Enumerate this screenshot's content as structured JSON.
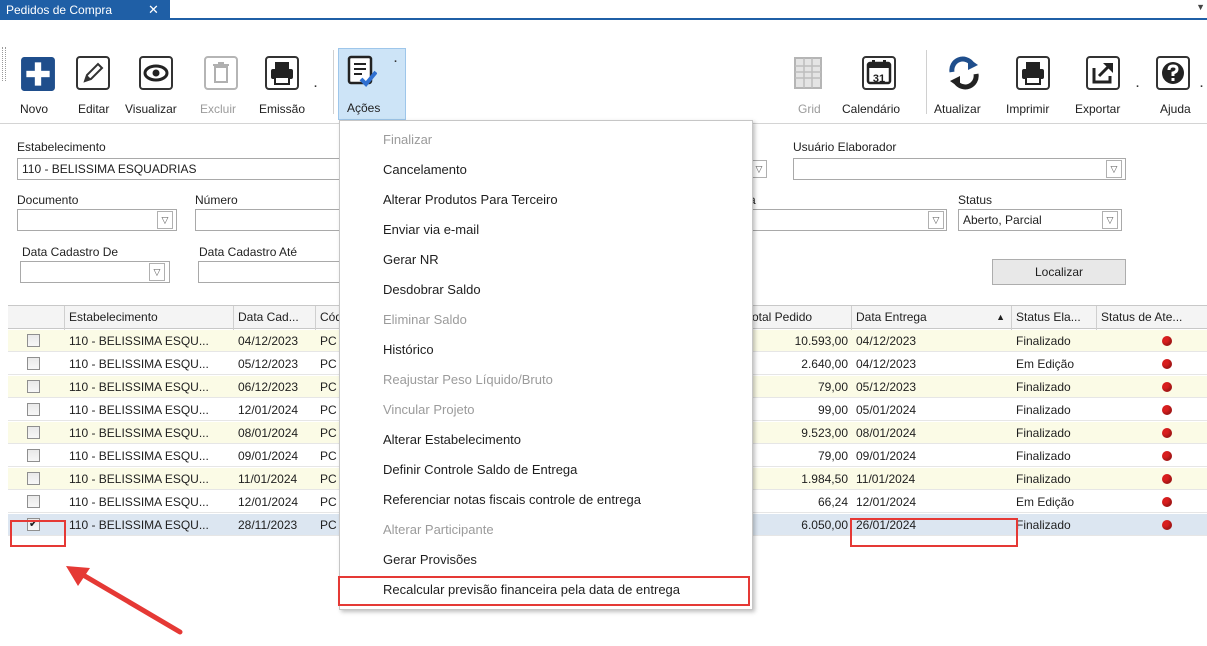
{
  "tab": {
    "title": "Pedidos de Compra",
    "close": "✕"
  },
  "toolbar": {
    "novo": "Novo",
    "editar": "Editar",
    "visualizar": "Visualizar",
    "excluir": "Excluir",
    "emissao": "Emissão",
    "acoes": "Ações",
    "grid": "Grid",
    "calendario": "Calendário",
    "calendar_day": "31",
    "atualizar": "Atualizar",
    "imprimir": "Imprimir",
    "exportar": "Exportar",
    "ajuda": "Ajuda"
  },
  "filters": {
    "estabelecimento_label": "Estabelecimento",
    "estabelecimento_value": "110 - BELISSIMA ESQUADRIAS",
    "usuario_label": "Usuário Elaborador",
    "usuario_value": "",
    "documento_label": "Documento",
    "numero_label": "Número",
    "status_label": "Status",
    "status_value": "Aberto, Parcial",
    "data_de_label": "Data Cadastro De",
    "data_ate_label": "Data Cadastro Até",
    "partial_label_a": "a",
    "localizar": "Localizar"
  },
  "grid": {
    "headers": {
      "estabelecimento": "Estabelecimento",
      "data_cad": "Data Cad...",
      "cod": "Cód",
      "total": "otal Pedido",
      "data_entrega": "Data Entrega",
      "sort_indicator": "▲",
      "status_ela": "Status Ela...",
      "status_ate": "Status de Ate..."
    },
    "rows": [
      {
        "checked": false,
        "estab": "110 - BELISSIMA ESQU...",
        "data": "04/12/2023",
        "cod": "PC",
        "total": "10.593,00",
        "entrega": "04/12/2023",
        "status": "Finalizado"
      },
      {
        "checked": false,
        "estab": "110 - BELISSIMA ESQU...",
        "data": "05/12/2023",
        "cod": "PC",
        "total": "2.640,00",
        "entrega": "04/12/2023",
        "status": "Em Edição"
      },
      {
        "checked": false,
        "estab": "110 - BELISSIMA ESQU...",
        "data": "06/12/2023",
        "cod": "PC",
        "total": "79,00",
        "entrega": "05/12/2023",
        "status": "Finalizado"
      },
      {
        "checked": false,
        "estab": "110 - BELISSIMA ESQU...",
        "data": "12/01/2024",
        "cod": "PC",
        "total": "99,00",
        "entrega": "05/01/2024",
        "status": "Finalizado"
      },
      {
        "checked": false,
        "estab": "110 - BELISSIMA ESQU...",
        "data": "08/01/2024",
        "cod": "PC",
        "total": "9.523,00",
        "entrega": "08/01/2024",
        "status": "Finalizado"
      },
      {
        "checked": false,
        "estab": "110 - BELISSIMA ESQU...",
        "data": "09/01/2024",
        "cod": "PC",
        "total": "79,00",
        "entrega": "09/01/2024",
        "status": "Finalizado"
      },
      {
        "checked": false,
        "estab": "110 - BELISSIMA ESQU...",
        "data": "11/01/2024",
        "cod": "PC",
        "total": "1.984,50",
        "entrega": "11/01/2024",
        "status": "Finalizado"
      },
      {
        "checked": false,
        "estab": "110 - BELISSIMA ESQU...",
        "data": "12/01/2024",
        "cod": "PC",
        "total": "66,24",
        "entrega": "12/01/2024",
        "status": "Em Edição"
      },
      {
        "checked": true,
        "estab": "110 - BELISSIMA ESQU...",
        "data": "28/11/2023",
        "cod": "PC",
        "total": "6.050,00",
        "entrega": "26/01/2024",
        "status": "Finalizado"
      }
    ]
  },
  "menu": {
    "items": [
      {
        "label": "Finalizar",
        "enabled": false
      },
      {
        "label": "Cancelamento",
        "enabled": true
      },
      {
        "label": "Alterar Produtos Para Terceiro",
        "enabled": true
      },
      {
        "label": "Enviar via e-mail",
        "enabled": true
      },
      {
        "label": "Gerar NR",
        "enabled": true
      },
      {
        "label": "Desdobrar Saldo",
        "enabled": true
      },
      {
        "label": "Eliminar Saldo",
        "enabled": false
      },
      {
        "label": "Histórico",
        "enabled": true
      },
      {
        "label": "Reajustar Peso Líquido/Bruto",
        "enabled": false
      },
      {
        "label": "Vincular Projeto",
        "enabled": false
      },
      {
        "label": "Alterar Estabelecimento",
        "enabled": true
      },
      {
        "label": "Definir Controle Saldo de Entrega",
        "enabled": true
      },
      {
        "label": "Referenciar notas fiscais controle de entrega",
        "enabled": true
      },
      {
        "label": "Alterar Participante",
        "enabled": false
      },
      {
        "label": "Gerar Provisões",
        "enabled": true
      },
      {
        "label": "Recalcular previsão financeira pela data de entrega",
        "enabled": true
      }
    ]
  },
  "colors": {
    "accent": "#1f5fa6",
    "highlight": "#e53935",
    "status_dot": "#d81e1e"
  }
}
